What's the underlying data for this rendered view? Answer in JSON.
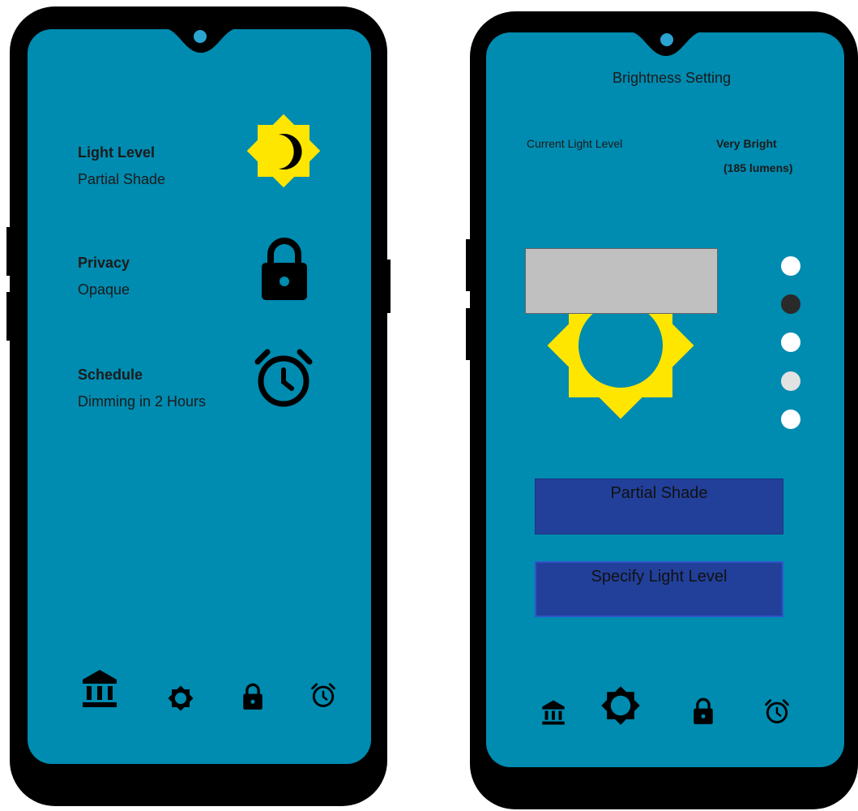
{
  "left_screen": {
    "items": [
      {
        "title": "Light Level",
        "value": "Partial Shade",
        "icon": "sun-moon-icon"
      },
      {
        "title": "Privacy",
        "value": "Opaque",
        "icon": "lock-icon"
      },
      {
        "title": "Schedule",
        "value": "Dimming in 2 Hours",
        "icon": "alarm-clock-icon"
      }
    ],
    "nav": [
      "home-icon",
      "gear-icon",
      "lock-icon",
      "alarm-clock-icon"
    ]
  },
  "right_screen": {
    "header": "Brightness Setting",
    "current_label": "Current Light Level",
    "current_value": "Very Bright",
    "current_lumens": "(185 lumens)",
    "level_selector": {
      "count": 5,
      "selected_index": 1
    },
    "buttons": {
      "preset": "Partial Shade",
      "specify": "Specify Light Level"
    },
    "nav": [
      "home-icon",
      "gear-icon",
      "lock-icon",
      "alarm-clock-icon"
    ]
  },
  "colors": {
    "screen_bg": "#008bb0",
    "accent_yellow": "#ffe600",
    "button_bg": "#22409a"
  }
}
